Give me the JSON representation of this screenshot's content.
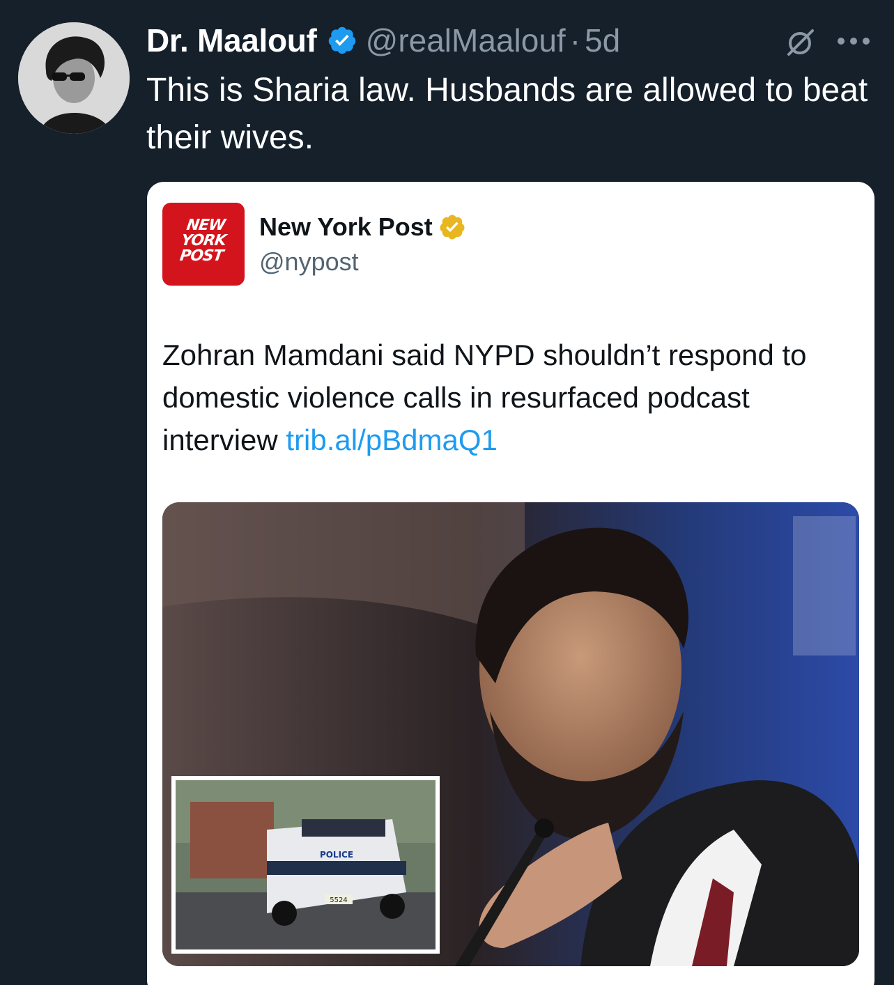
{
  "tweet": {
    "author_name": "Dr. Maalouf",
    "handle": "@realMaalouf",
    "separator": "·",
    "time": "5d",
    "text": "This is Sharia law. Husbands are allowed to beat their wives.",
    "icons": [
      "verified-badge-icon",
      "grok-icon",
      "more-icon"
    ],
    "colors": {
      "background": "#15202b",
      "verified": "#1d9bf0",
      "muted": "#8b98a5"
    }
  },
  "quoted": {
    "logo_text": [
      "NEW",
      "YORK",
      "POST"
    ],
    "author_name": "New York Post",
    "handle": "@nypost",
    "text": "Zohran Mamdani said NYPD shouldn’t respond to domestic violence calls in resurfaced podcast interview",
    "link": "trib.al/pBdmaQ1",
    "colors": {
      "brand": "#d4141d",
      "gold_badge": "#e8b720",
      "link": "#1d9bf0"
    },
    "photo": {
      "inset_text": "POLICE",
      "inset_plate": "5524"
    }
  }
}
